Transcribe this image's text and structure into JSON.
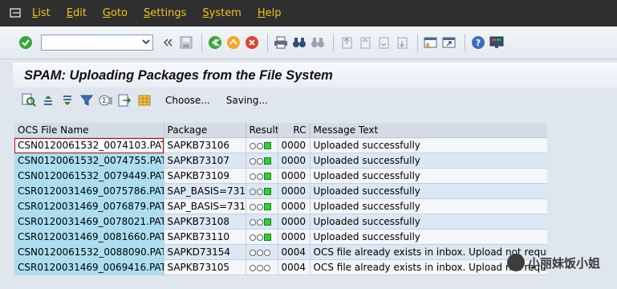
{
  "menubar": {
    "items": [
      {
        "label": "List",
        "u": "L",
        "rest": "ist"
      },
      {
        "label": "Edit",
        "u": "E",
        "rest": "dit"
      },
      {
        "label": "Goto",
        "u": "G",
        "rest": "oto"
      },
      {
        "label": "Settings",
        "u": "S",
        "rest": "ettings"
      },
      {
        "label": "System",
        "u": "S",
        "rest": "ystem"
      },
      {
        "label": "Help",
        "u": "H",
        "rest": "elp"
      }
    ]
  },
  "stdbar": {
    "command_value": ""
  },
  "title": "SPAM: Uploading Packages from the File System",
  "appbar": {
    "choose_label": "Choose...",
    "saving_label": "Saving..."
  },
  "table": {
    "columns": [
      "OCS File Name",
      "Package",
      "Result",
      "RC",
      "Message Text"
    ],
    "rows": [
      {
        "file": "CSN0120061532_0074103.PAT",
        "package": "SAPKB73106",
        "result": "green",
        "rc": "0000",
        "message": "Uploaded successfully"
      },
      {
        "file": "CSN0120061532_0074755.PAT",
        "package": "SAPKB73107",
        "result": "green",
        "rc": "0000",
        "message": "Uploaded successfully"
      },
      {
        "file": "CSN0120061532_0079449.PAT",
        "package": "SAPKB73109",
        "result": "green",
        "rc": "0000",
        "message": "Uploaded successfully"
      },
      {
        "file": "CSR0120031469_0075786.PAT",
        "package": "SAP_BASIS=731",
        "result": "green",
        "rc": "0000",
        "message": "Uploaded successfully"
      },
      {
        "file": "CSR0120031469_0076879.PAT",
        "package": "SAP_BASIS=731",
        "result": "green",
        "rc": "0000",
        "message": "Uploaded successfully"
      },
      {
        "file": "CSR0120031469_0078021.PAT",
        "package": "SAPKB73108",
        "result": "green",
        "rc": "0000",
        "message": "Uploaded successfully"
      },
      {
        "file": "CSR0120031469_0081660.PAT",
        "package": "SAPKB73110",
        "result": "green",
        "rc": "0000",
        "message": "Uploaded successfully"
      },
      {
        "file": "CSN0120061532_0088090.PAT",
        "package": "SAPKD73154",
        "result": "none",
        "rc": "0004",
        "message": "OCS file already exists in inbox. Upload not required."
      },
      {
        "file": "CSR0120031469_0069416.PAT",
        "package": "SAPKB73105",
        "result": "none",
        "rc": "0004",
        "message": "OCS file already exists in inbox. Upload not required."
      }
    ]
  },
  "watermark": "小丽妹饭小姐",
  "colors": {
    "menu_text": "#f0c419",
    "key_column": "#a9dff0",
    "status_green": "#2fd02f"
  }
}
